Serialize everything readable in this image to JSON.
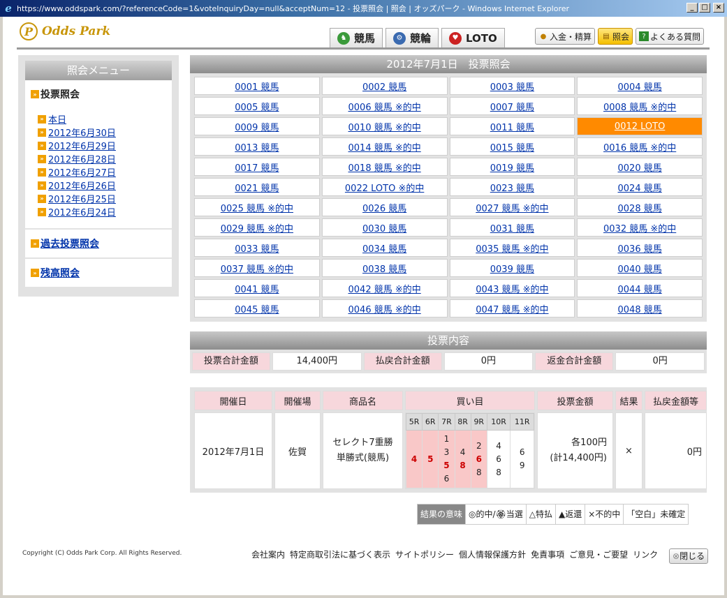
{
  "window": {
    "title": "https://www.oddspark.com/?referenceCode=1&voteInquiryDay=null&acceptNum=12 - 投票照会 | 照会 | オッズパーク - Windows Internet Explorer",
    "min": "_",
    "max": "□",
    "close": "×"
  },
  "logo": {
    "text": "Odds Park",
    "mark": "P"
  },
  "nav": [
    {
      "label": "競馬"
    },
    {
      "label": "競輪"
    },
    {
      "label": "LOTO"
    }
  ],
  "util": [
    {
      "label": "入金・精算"
    },
    {
      "label": "照会"
    },
    {
      "label": "よくある質問"
    }
  ],
  "sidebar": {
    "title": "照会メニュー",
    "section": "投票照会",
    "dates": [
      "本日",
      "2012年6月30日",
      "2012年6月29日",
      "2012年6月28日",
      "2012年6月27日",
      "2012年6月26日",
      "2012年6月25日",
      "2012年6月24日"
    ],
    "past": "過去投票照会",
    "balance": "残高照会"
  },
  "main": {
    "title": "2012年7月1日　投票照会",
    "tickets": [
      [
        "0001 競馬",
        "0002 競馬",
        "0003 競馬",
        "0004 競馬"
      ],
      [
        "0005 競馬",
        "0006 競馬 ※的中",
        "0007 競馬",
        "0008 競馬 ※的中"
      ],
      [
        "0009 競馬",
        "0010 競馬 ※的中",
        "0011 競馬",
        "0012 LOTO"
      ],
      [
        "0013 競馬",
        "0014 競馬 ※的中",
        "0015 競馬",
        "0016 競馬 ※的中"
      ],
      [
        "0017 競馬",
        "0018 競馬 ※的中",
        "0019 競馬",
        "0020 競馬"
      ],
      [
        "0021 競馬",
        "0022 LOTO ※的中",
        "0023 競馬",
        "0024 競馬"
      ],
      [
        "0025 競馬 ※的中",
        "0026 競馬",
        "0027 競馬 ※的中",
        "0028 競馬"
      ],
      [
        "0029 競馬 ※的中",
        "0030 競馬",
        "0031 競馬",
        "0032 競馬 ※的中"
      ],
      [
        "0033 競馬",
        "0034 競馬",
        "0035 競馬 ※的中",
        "0036 競馬"
      ],
      [
        "0037 競馬 ※的中",
        "0038 競馬",
        "0039 競馬",
        "0040 競馬"
      ],
      [
        "0041 競馬",
        "0042 競馬 ※的中",
        "0043 競馬 ※的中",
        "0044 競馬"
      ],
      [
        "0045 競馬",
        "0046 競馬 ※的中",
        "0047 競馬 ※的中",
        "0048 競馬"
      ]
    ],
    "selected": "0012 LOTO"
  },
  "summary": {
    "title": "投票内容",
    "total_bet_label": "投票合計金額",
    "total_bet": "14,400円",
    "payout_label": "払戻合計金額",
    "payout": "0円",
    "refund_label": "返金合計金額",
    "refund": "0円"
  },
  "result": {
    "headers": [
      "開催日",
      "開催場",
      "商品名",
      "買い目",
      "投票金額",
      "結果",
      "払戻金額等"
    ],
    "date": "2012年7月1日",
    "venue": "佐賀",
    "product_line1": "セレクト7重勝",
    "product_line2": "単勝式(競馬)",
    "legs": [
      {
        "race": "5R",
        "nums": [
          "4"
        ],
        "hit": [
          "4"
        ]
      },
      {
        "race": "6R",
        "nums": [
          "5"
        ],
        "hit": [
          "5"
        ]
      },
      {
        "race": "7R",
        "nums": [
          "1",
          "3",
          "5",
          "6"
        ],
        "hit": [
          "5"
        ]
      },
      {
        "race": "8R",
        "nums": [
          "4",
          "8"
        ],
        "hit": [
          "8"
        ]
      },
      {
        "race": "9R",
        "nums": [
          "2",
          "6",
          "8"
        ],
        "hit": [
          "6"
        ]
      },
      {
        "race": "10R",
        "nums": [
          "4",
          "6",
          "8"
        ],
        "hit": []
      },
      {
        "race": "11R",
        "nums": [
          "6",
          "9"
        ],
        "hit": []
      }
    ],
    "amount_line1": "各100円",
    "amount_line2": "(計14,400円)",
    "outcome": "×",
    "payout": "0円"
  },
  "legend": [
    "結果の意味",
    "◎的中/🏵当選",
    "△特払",
    "▲返還",
    "×不的中",
    "「空白」未確定"
  ],
  "footer": {
    "copyright": "Copyright (C) Odds Park Corp. All Rights Reserved.",
    "links": [
      "会社案内",
      "特定商取引法に基づく表示",
      "サイトポリシー",
      "個人情報保護方針",
      "免責事項",
      "ご意見・ご要望",
      "リンク"
    ],
    "close": "閉じる"
  }
}
